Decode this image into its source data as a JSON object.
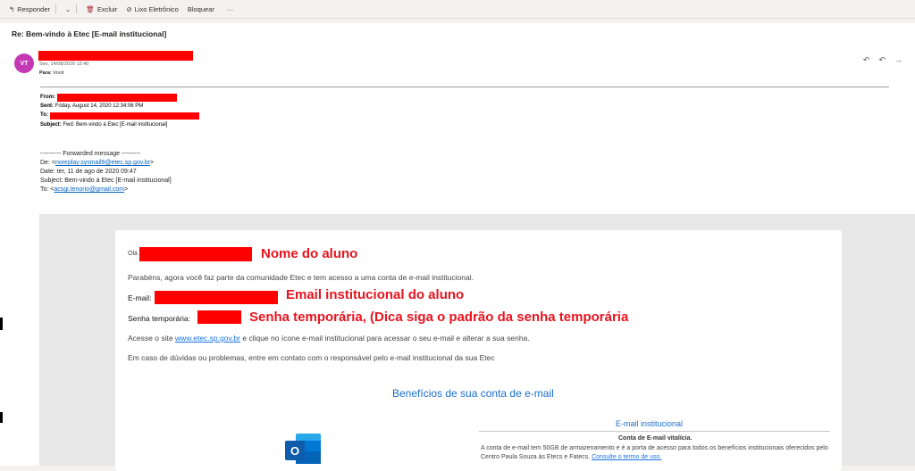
{
  "toolbar": {
    "reply": "Responder",
    "delete": "Excluir",
    "junk": "Lixo Eletrônico",
    "block": "Bloquear",
    "more": "···"
  },
  "subject": "Re: Bem-vindo à Etec [E-mail institucional]",
  "message": {
    "avatar": "VT",
    "date": "Sex, 14/08/2020 12:40",
    "to_label": "Para:",
    "to_value": "Você"
  },
  "inner_header": {
    "from_label": "From:",
    "sent_label": "Sent:",
    "sent_value": "Friday, August 14, 2020 12:34:06 PM",
    "to_label": "To:",
    "subject_label": "Subject:",
    "subject_value": "Fwd: Bem-vindo à Etec [E-mail institucional]"
  },
  "forwarded": {
    "divider": "---------- Forwarded message ---------",
    "de_label": "De: <",
    "de_email": "noreplay.sysmail9@etec.sp.gov.br",
    "de_close": ">",
    "date": "Date: ter, 11 de ago de 2020 09:47",
    "subject": "Subject: Bem-vindo à Etec [E-mail institucional]",
    "to_label": "To: <",
    "to_email": "acsgi.tenorio@gmail.com",
    "to_close": ">"
  },
  "card": {
    "greeting": "Olá",
    "annot_name": "Nome do aluno",
    "congrats": "Parabéns, agora você faz parte da comunidade Etec e tem acesso a uma conta de e-mail institucional.",
    "email_label": "E-mail:",
    "annot_email": "Email institucional do aluno",
    "pwd_label": "Senha temporária:",
    "annot_pwd": "Senha temporária, (Dica  siga o padrão da senha temporária",
    "access_pre": "Acesse o site ",
    "access_link": "www.etec.sp.gov.br",
    "access_post": " e clique no ícone e-mail institucional para acessar o seu e-mail e alterar a sua senha.",
    "doubts": "Em caso de dúvidas ou problemas,  entre em contato com o responsável pelo e-mail institucional da sua Etec",
    "benefits_title": "Benefícios de sua conta de e-mail",
    "einst_title": "E-mail institucional",
    "vital": "Conta de E-mail vitalícia.",
    "desc": "A conta de e-mail tem 50GB de armazenamento e é a porta de acesso para todos os benefícios institucionais oferecidos pelo Centro Paula Souza às Etecs e Fatecs. ",
    "desc_link": "Consulte o termo de uso."
  },
  "colors": {
    "accent": "#c239b3",
    "redaction": "#ff0000",
    "annotation": "#e8141e",
    "link": "#1a6fcf"
  }
}
